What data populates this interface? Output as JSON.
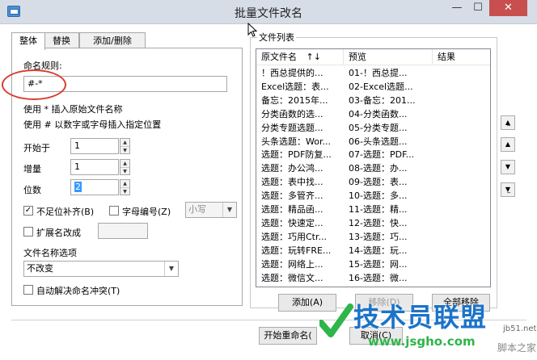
{
  "window": {
    "title": "批量文件改名",
    "minimize": "—",
    "maximize": "☐",
    "close": "✕"
  },
  "tabs": [
    {
      "label": "整体"
    },
    {
      "label": "替换"
    },
    {
      "label": "添加/删除"
    }
  ],
  "rule": {
    "label": "命名规则:",
    "value": "#-*",
    "hint1": "使用 * 插入原始文件名称",
    "hint2": "使用 # 以数字或字母插入指定位置"
  },
  "start": {
    "label": "开始于",
    "value": "1"
  },
  "increment": {
    "label": "增量",
    "value": "1"
  },
  "digits": {
    "label": "位数",
    "value": "2"
  },
  "pad": {
    "label": "不足位补齐(B)",
    "checked": "✓"
  },
  "letter": {
    "label": "字母编号(Z)",
    "case": "小写"
  },
  "ext": {
    "label": "扩展名改成"
  },
  "name_option": {
    "label": "文件名称选项",
    "value": "不改变"
  },
  "auto": {
    "label": "自动解决命名冲突(T)"
  },
  "filelist": {
    "title": "文件列表",
    "columns": {
      "original": "原文件名",
      "sort": "↑↓",
      "preview": "预览",
      "result": "结果"
    },
    "rows": [
      {
        "o": "！西总提供的...",
        "p": "01-！西总提..."
      },
      {
        "o": "Excel选题：表...",
        "p": "02-Excel选题..."
      },
      {
        "o": "备忘：2015年...",
        "p": "03-备忘：201..."
      },
      {
        "o": "分类函数的选...",
        "p": "04-分类函数..."
      },
      {
        "o": "分类专题选题...",
        "p": "05-分类专题..."
      },
      {
        "o": "头条选题：Wor...",
        "p": "06-头条选题..."
      },
      {
        "o": "选题：PDF防复...",
        "p": "07-选题：PDF..."
      },
      {
        "o": "选题：办公鸿...",
        "p": "08-选题：办..."
      },
      {
        "o": "选题：表中找...",
        "p": "09-选题：表..."
      },
      {
        "o": "选题：多管齐...",
        "p": "10-选题：多..."
      },
      {
        "o": "选题：精品函...",
        "p": "11-选题：精..."
      },
      {
        "o": "选题：快速定...",
        "p": "12-选题：快..."
      },
      {
        "o": "选题：巧用Ctr...",
        "p": "13-选题：巧..."
      },
      {
        "o": "选题：玩转FRE...",
        "p": "14-选题：玩..."
      },
      {
        "o": "选题：网络上...",
        "p": "15-选题：网..."
      },
      {
        "o": "选题：微信文...",
        "p": "16-选题：微..."
      }
    ]
  },
  "buttons": {
    "add": "添加(A)",
    "remove": "移除(D)",
    "remove_all": "全部移除",
    "start": "开始重命名(",
    "cancel": "取消(C)"
  },
  "side": {
    "top": "▲̲",
    "up": "▲",
    "down": "▼",
    "bottom": "▼̲"
  },
  "watermark": {
    "brand": "技术员联盟",
    "url": "www.jsgho.com",
    "site": "jb51.net",
    "corner": "脚本之家"
  },
  "colors": {
    "accent_red": "#d83c2e",
    "watermark_blue": "#1b73c9",
    "watermark_green": "#2fb54a"
  }
}
